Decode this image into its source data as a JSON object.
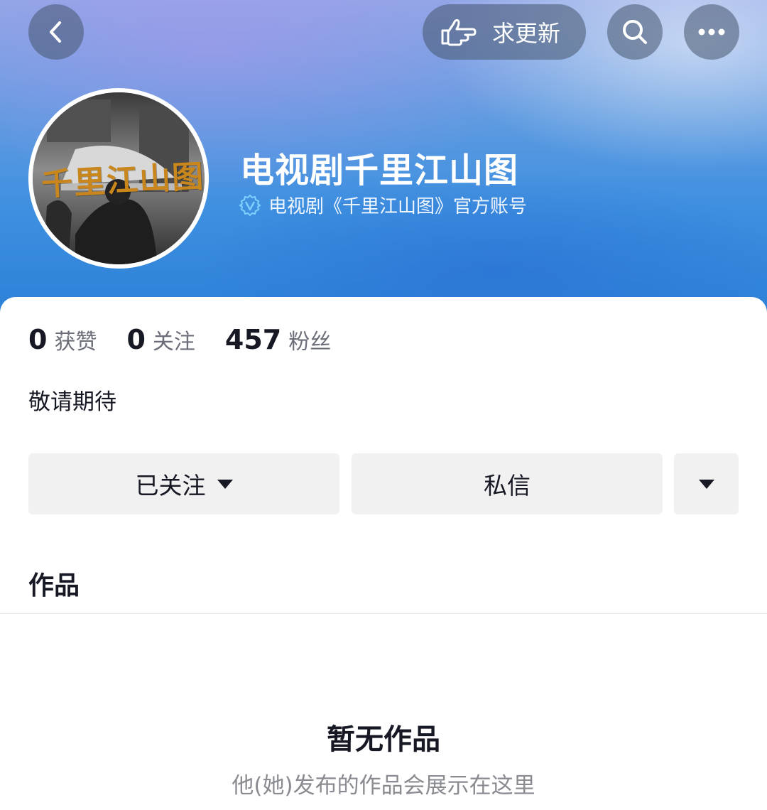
{
  "header": {
    "update_label": "求更新",
    "icons": {
      "back": "chevron-left-icon",
      "update": "pointing-hand-icon",
      "search": "search-icon",
      "more": "more-dots-icon"
    }
  },
  "profile": {
    "name": "电视剧千里江山图",
    "verification": "电视剧《千里江山图》官方账号",
    "avatar_text": "千里江山图",
    "bio": "敬请期待"
  },
  "stats": [
    {
      "value": "0",
      "label": "获赞"
    },
    {
      "value": "0",
      "label": "关注"
    },
    {
      "value": "457",
      "label": "粉丝"
    }
  ],
  "actions": {
    "follow_label": "已关注",
    "message_label": "私信"
  },
  "works": {
    "title": "作品",
    "empty_title": "暂无作品",
    "empty_subtitle": "他(她)发布的作品会展示在这里"
  },
  "colors": {
    "header_gradient_top": "#8fa8e6",
    "header_gradient_bottom": "#2a7fd6",
    "avatar_text": "#c8861c",
    "button_bg": "#f1f1f2"
  }
}
